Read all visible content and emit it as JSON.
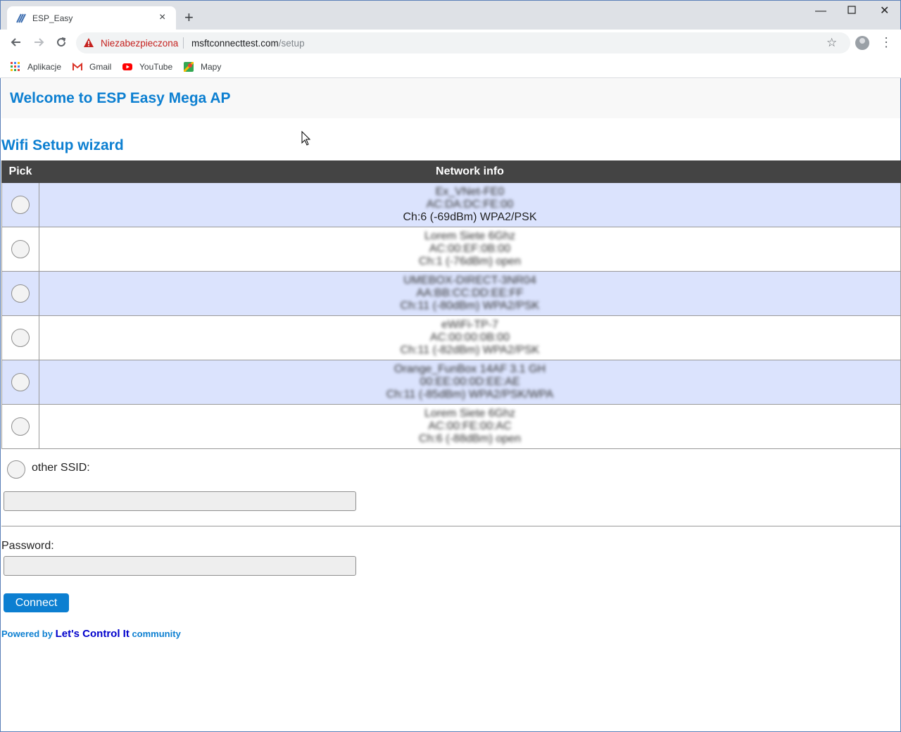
{
  "browser": {
    "tab_title": "ESP_Easy",
    "tab_close": "×",
    "new_tab": "+",
    "security_label": "Niezabezpieczona",
    "url_host": "msftconnecttest.com",
    "url_path": "/setup",
    "bookmarks": [
      "Aplikacje",
      "Gmail",
      "YouTube",
      "Mapy"
    ]
  },
  "page": {
    "header": "Welcome to ESP Easy Mega AP",
    "subheader": "Wifi Setup wizard",
    "table": {
      "columns": [
        "Pick",
        "Network info"
      ],
      "rows": [
        {
          "ssid": "Ex_VNet-FE0",
          "bssid": "AC:DA:DC:FE:00",
          "details": "Ch:6 (-69dBm) WPA2/PSK",
          "details_readable": true
        },
        {
          "ssid": "Lorem Siete 6Ghz",
          "bssid": "AC:00:EF:0B:00",
          "details": "Ch:1 (-76dBm) open",
          "details_readable": false
        },
        {
          "ssid": "UMEBOX-DIRECT-3NR04",
          "bssid": "AA:BB:CC:DD:EE:FF",
          "details": "Ch:11 (-80dBm) WPA2/PSK",
          "details_readable": false
        },
        {
          "ssid": "eWiFi-TP-7",
          "bssid": "AC:00:00:0B:00",
          "details": "Ch:11 (-82dBm) WPA2/PSK",
          "details_readable": false
        },
        {
          "ssid": "Orange_FunBox 14AF 3.1 GH",
          "bssid": "00:EE:00:0D:EE:AE",
          "details": "Ch:11 (-85dBm) WPA2/PSK/WPA",
          "details_readable": false
        },
        {
          "ssid": "Lorem Siete 6Ghz",
          "bssid": "AC:00:FE:00:AC",
          "details": "Ch:6 (-88dBm) open",
          "details_readable": false
        }
      ]
    },
    "other_ssid_label": "other SSID:",
    "password_label": "Password:",
    "connect_label": "Connect",
    "footer": {
      "prefix": "Powered by",
      "link": "Let's Control It",
      "suffix": "community"
    }
  }
}
